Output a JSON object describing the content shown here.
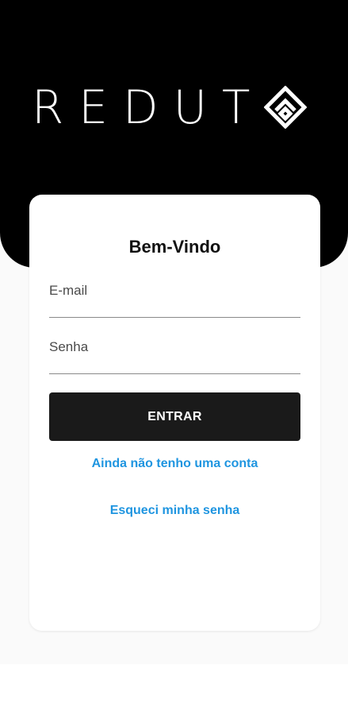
{
  "header": {
    "brand_text": "REDUT",
    "logo_icon": "diamond-logo-icon",
    "background": "#000000"
  },
  "login": {
    "title": "Bem-Vindo",
    "email_placeholder": "E-mail",
    "email_value": "",
    "password_placeholder": "Senha",
    "password_value": "",
    "submit_label": "ENTRAR",
    "signup_link": "Ainda não tenho uma conta",
    "forgot_link": "Esqueci minha senha",
    "link_color": "#1f95e0",
    "button_color": "#1a1a1a"
  }
}
